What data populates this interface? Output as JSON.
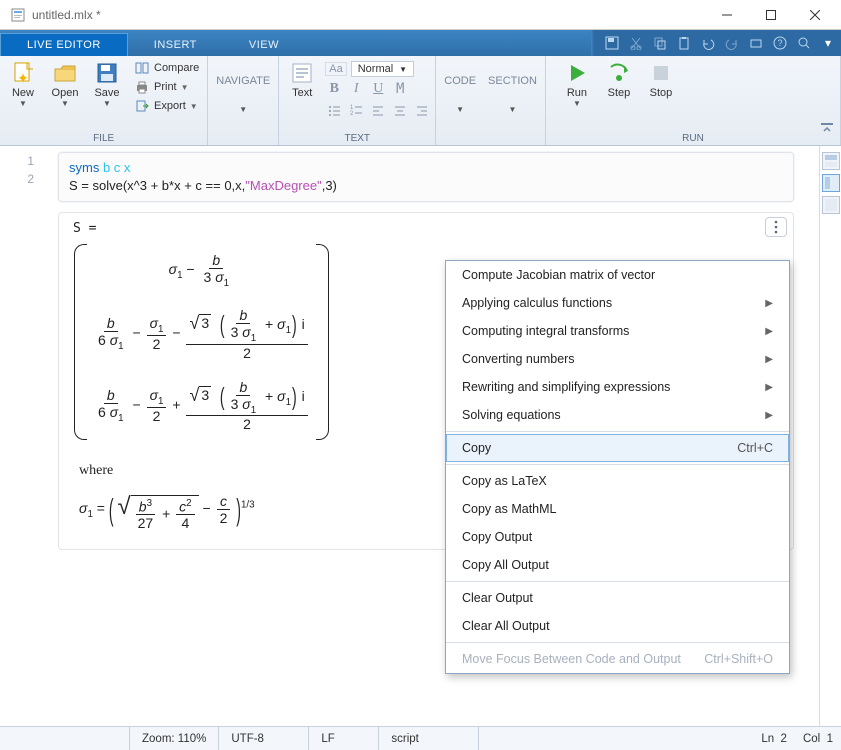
{
  "title": "untitled.mlx *",
  "tabs": {
    "t0": "LIVE EDITOR",
    "t1": "INSERT",
    "t2": "VIEW"
  },
  "file": {
    "new": "New",
    "open": "Open",
    "save": "Save",
    "compare": "Compare",
    "print": "Print",
    "export": "Export",
    "group": "FILE"
  },
  "nav": {
    "label": "NAVIGATE"
  },
  "text": {
    "btn": "Text",
    "normal": "Normal",
    "group": "TEXT"
  },
  "code": {
    "code": "CODE",
    "section": "SECTION"
  },
  "run": {
    "run": "Run",
    "step": "Step",
    "stop": "Stop",
    "group": "RUN"
  },
  "codeLines": {
    "l1": "1",
    "l2": "2"
  },
  "codeText": {
    "syms": "syms",
    "vars": " b c x",
    "line2a": "S = solve(x^3 + b*x + c == 0,x,",
    "str": "\"MaxDegree\"",
    "line2b": ",3)"
  },
  "output": {
    "prefix": "S =",
    "where": "where"
  },
  "ctxmenu": {
    "i0": "Compute Jacobian matrix of vector",
    "i1": "Applying calculus functions",
    "i2": "Computing integral transforms",
    "i3": "Converting numbers",
    "i4": "Rewriting and simplifying expressions",
    "i5": "Solving equations",
    "i6": "Copy",
    "i6s": "Ctrl+C",
    "i7": "Copy as LaTeX",
    "i8": "Copy as MathML",
    "i9": "Copy Output",
    "i10": "Copy All Output",
    "i11": "Clear Output",
    "i12": "Clear All Output",
    "i13": "Move Focus Between Code and Output",
    "i13s": "Ctrl+Shift+O"
  },
  "status": {
    "zoom": "Zoom: 110%",
    "enc": "UTF-8",
    "eol": "LF",
    "mode": "script",
    "ln": "Ln",
    "lnval": "2",
    "col": "Col",
    "colval": "1"
  }
}
